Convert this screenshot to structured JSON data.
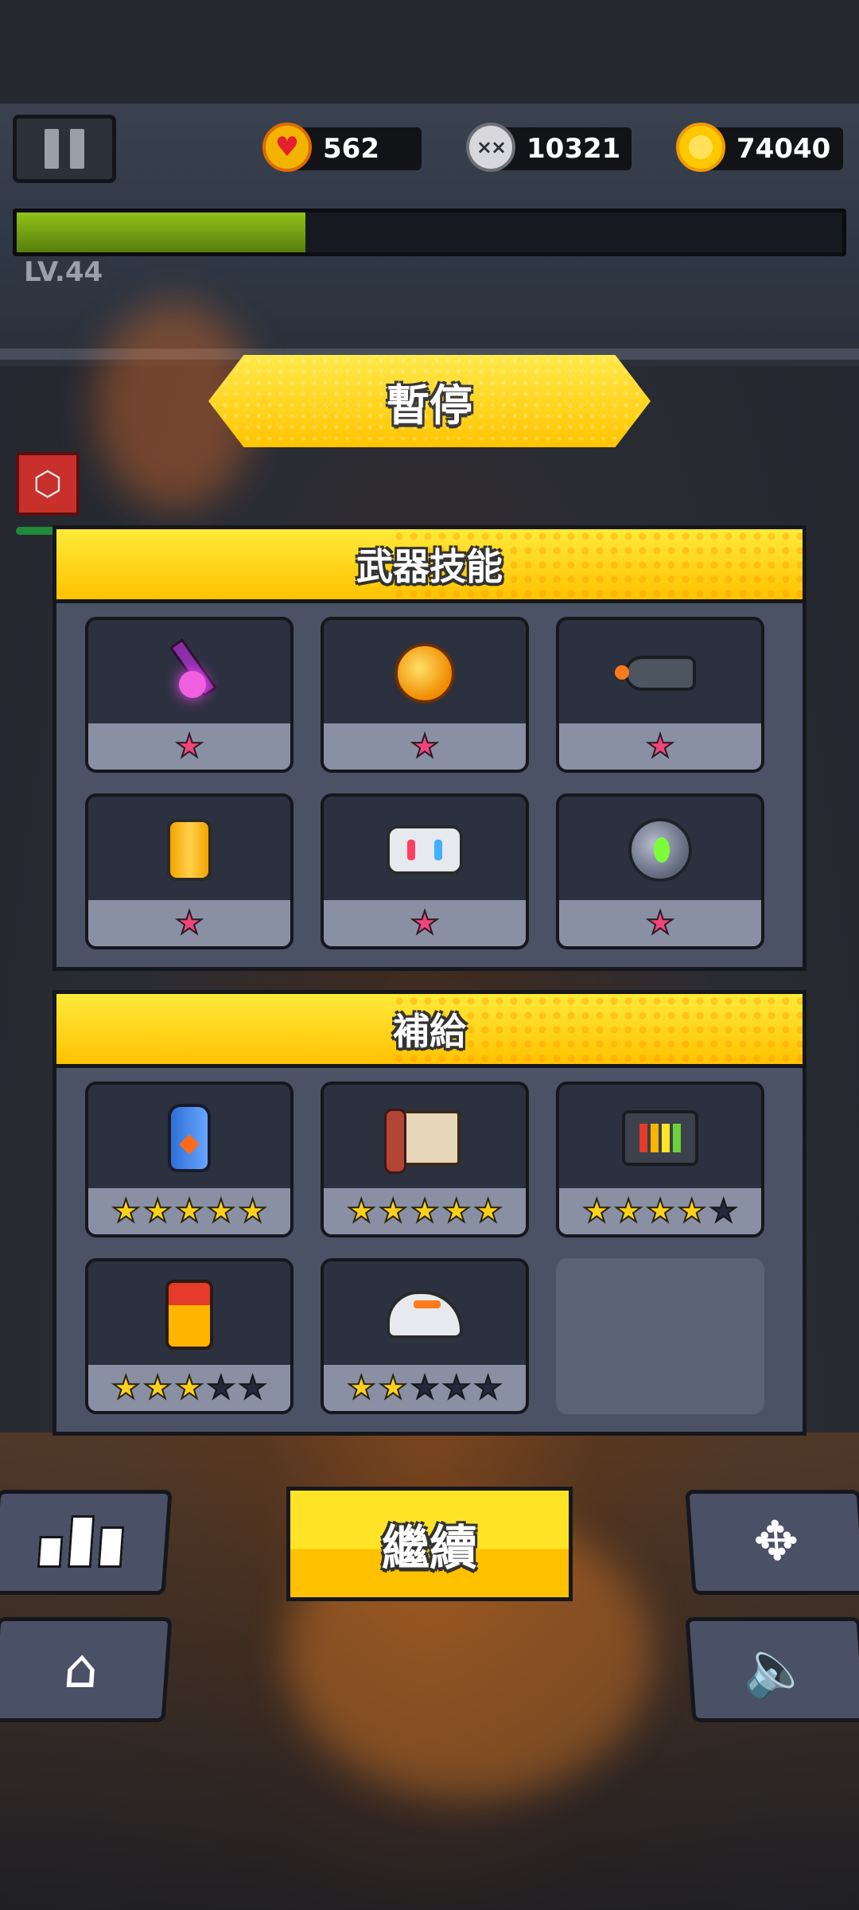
{
  "hud": {
    "hp": "562",
    "kills": "10321",
    "coins": "74040",
    "xp_progress": 0.35,
    "level": "LV.44"
  },
  "title": "暫停",
  "weapons": {
    "title": "武器技能",
    "items": [
      {
        "name": "purple-blade",
        "stars": 1,
        "max_stars": 1
      },
      {
        "name": "fire-paw",
        "stars": 1,
        "max_stars": 1
      },
      {
        "name": "shark-rocket",
        "stars": 1,
        "max_stars": 1
      },
      {
        "name": "energy-canister",
        "stars": 1,
        "max_stars": 1
      },
      {
        "name": "robot-drone",
        "stars": 1,
        "max_stars": 1
      },
      {
        "name": "eye-orb",
        "stars": 1,
        "max_stars": 1
      }
    ]
  },
  "supplies": {
    "title": "補給",
    "items": [
      {
        "name": "blue-bottle",
        "stars": 5,
        "max_stars": 5
      },
      {
        "name": "scroll",
        "stars": 5,
        "max_stars": 5
      },
      {
        "name": "battery-pack",
        "stars": 4,
        "max_stars": 5
      },
      {
        "name": "fuel-tank",
        "stars": 3,
        "max_stars": 5
      },
      {
        "name": "sneaker",
        "stars": 2,
        "max_stars": 5
      }
    ]
  },
  "buttons": {
    "continue": "繼續"
  },
  "colors": {
    "accent_yellow": "#ffc400",
    "panel": "#4b5266",
    "xp_green": "#7cb518",
    "star_pink": "#f0457a",
    "star_gold": "#ffd21a"
  },
  "icons": {
    "pause": "pause-icon",
    "hp": "heart-icon",
    "kills": "skull-icon",
    "coins": "coin-icon",
    "stats": "bar-chart-icon",
    "home": "home-icon",
    "joystick": "dpad-icon",
    "sound": "speaker-icon"
  }
}
